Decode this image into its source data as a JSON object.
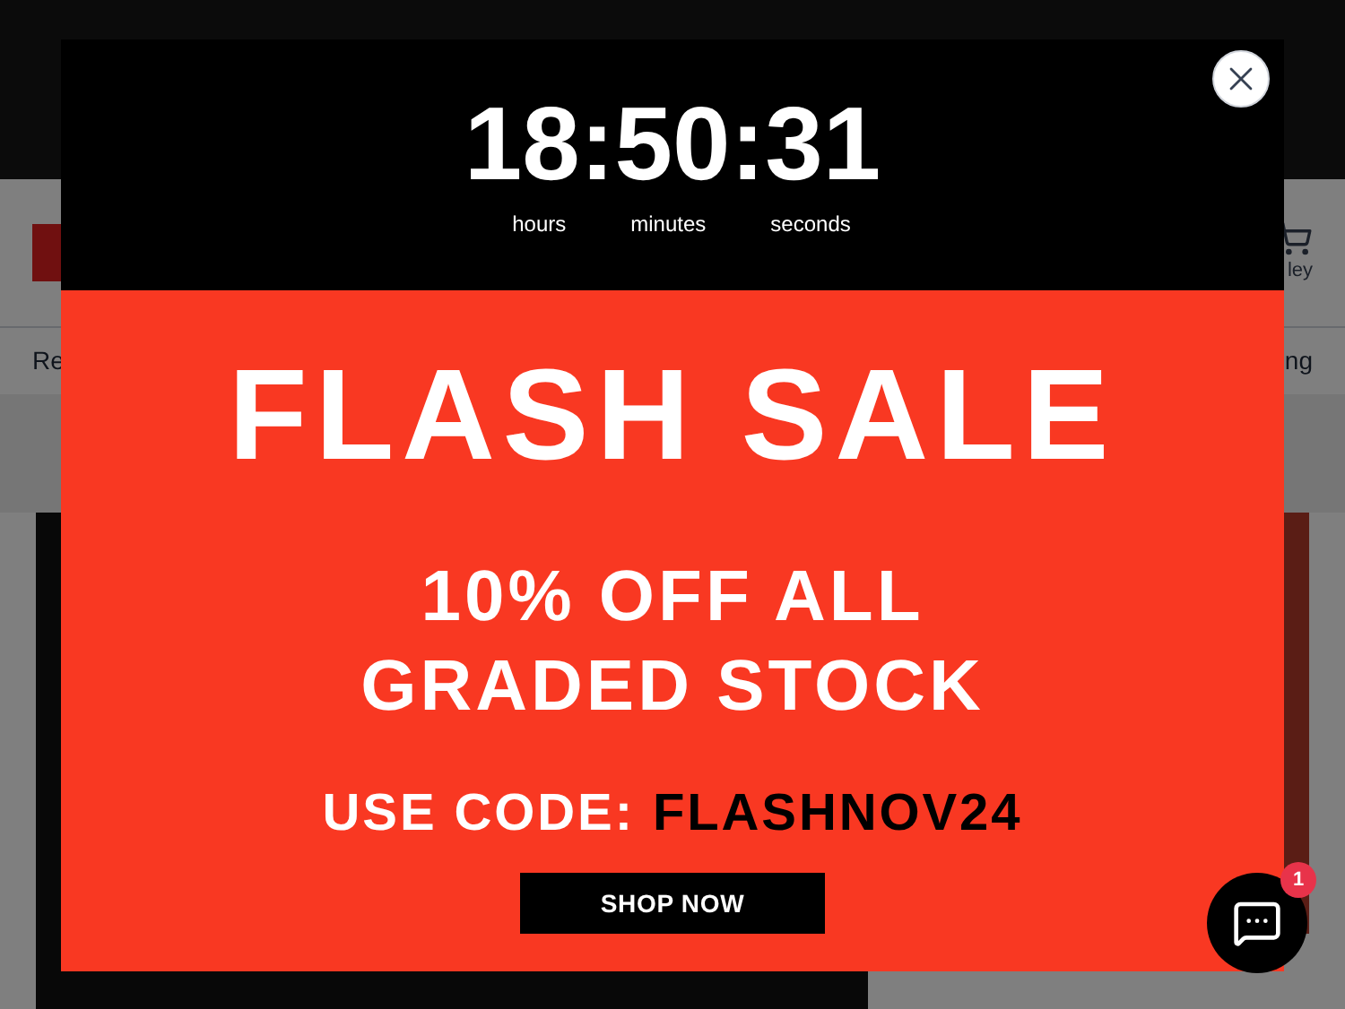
{
  "header": {
    "cart_label": "ley"
  },
  "nav": {
    "left_item": "Re",
    "right_item": "ng"
  },
  "popup": {
    "countdown": "18:50:31",
    "units": [
      "hours",
      "minutes",
      "seconds"
    ],
    "title": "FLASH SALE",
    "subtitle_lines": [
      "10% OFF ALL",
      "GRADED STOCK"
    ],
    "code_label": "USE CODE:",
    "code": "FLASHNOV24",
    "button": "SHOP NOW"
  },
  "chat": {
    "badge": "1"
  }
}
